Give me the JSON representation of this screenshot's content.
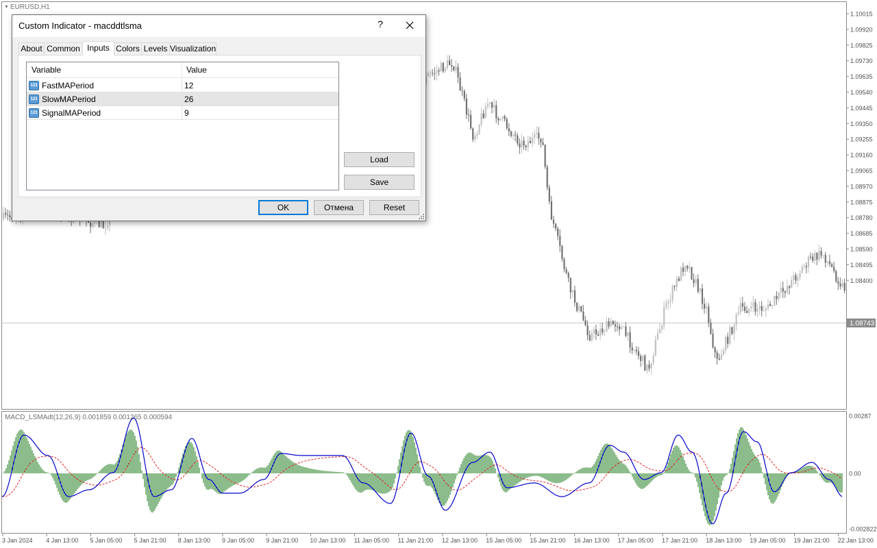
{
  "chart": {
    "symbol": "EURUSD,H1",
    "indicator_label": "MACD_LSMAdt(12,26,9) 0.001859 0.001265 0.000594",
    "price_axis": [
      "1.10015",
      "1.09920",
      "1.09825",
      "1.09730",
      "1.09635",
      "1.09540",
      "1.09445",
      "1.09350",
      "1.09255",
      "1.09160",
      "1.09065",
      "1.08970",
      "1.08875",
      "1.08780",
      "1.08685",
      "1.08590",
      "1.08495",
      "1.08400"
    ],
    "current_price": "1.08743",
    "indicator_axis": [
      "0.00287",
      "0.00",
      "-0.002822"
    ],
    "time_axis": [
      "3 Jan 2024",
      "4 Jan 13:00",
      "5 Jan 05:00",
      "5 Jan 21:00",
      "8 Jan 13:00",
      "9 Jan 05:00",
      "9 Jan 21:00",
      "10 Jan 13:00",
      "11 Jan 05:00",
      "11 Jan 21:00",
      "12 Jan 13:00",
      "15 Jan 05:00",
      "15 Jan 21:00",
      "16 Jan 13:00",
      "17 Jan 05:00",
      "17 Jan 21:00",
      "18 Jan 13:00",
      "19 Jan 05:00",
      "19 Jan 21:00",
      "22 Jan 13:00"
    ],
    "colors": {
      "bull_candle": "#c0c0c0",
      "bear_candle": "#707070",
      "macd_line": "#0000cc",
      "signal_line": "#e02020",
      "histogram": "#1a7a1a",
      "current_price_tag": "#8c8c8c"
    }
  },
  "dialog": {
    "title": "Custom Indicator - macddtlsma",
    "help_label": "?",
    "close_icon": "close-icon",
    "tabs": [
      {
        "label": "About"
      },
      {
        "label": "Common"
      },
      {
        "label": "Inputs"
      },
      {
        "label": "Colors"
      },
      {
        "label": "Levels"
      },
      {
        "label": "Visualization"
      }
    ],
    "active_tab": "Inputs",
    "grid": {
      "col_variable": "Variable",
      "col_value": "Value",
      "rows": [
        {
          "name": "FastMAPeriod",
          "value": "12",
          "icon": "123"
        },
        {
          "name": "SlowMAPeriod",
          "value": "26",
          "icon": "123"
        },
        {
          "name": "SignalMAPeriod",
          "value": "9",
          "icon": "123"
        }
      ],
      "selected_row": "SlowMAPeriod"
    },
    "buttons": {
      "load": "Load",
      "save": "Save",
      "ok": "OK",
      "cancel": "Отмена",
      "reset": "Reset"
    }
  }
}
